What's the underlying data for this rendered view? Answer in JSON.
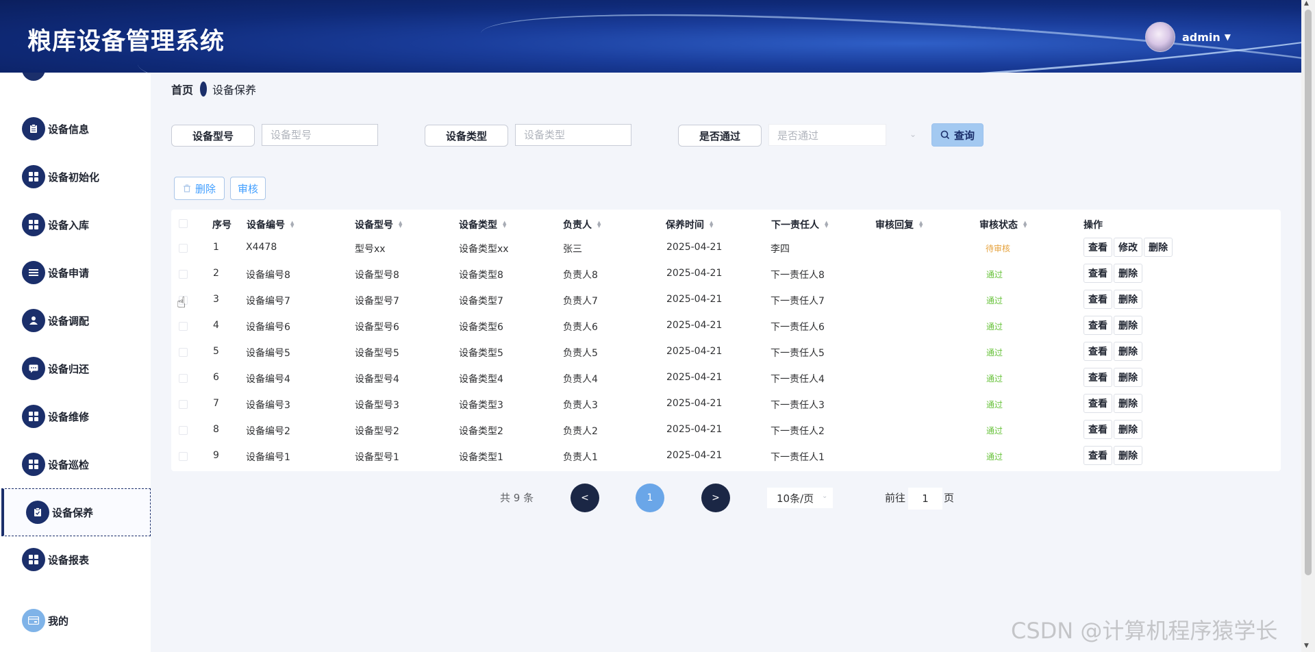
{
  "app": {
    "title": "粮库设备管理系统"
  },
  "user": {
    "name": "admin"
  },
  "breadcrumb": {
    "home": "首页",
    "current": "设备保养"
  },
  "sidebar": {
    "items": [
      {
        "label": "设备信息",
        "icon": "clipboard-icon"
      },
      {
        "label": "设备初始化",
        "icon": "grid-icon"
      },
      {
        "label": "设备入库",
        "icon": "grid-icon"
      },
      {
        "label": "设备申请",
        "icon": "list-icon"
      },
      {
        "label": "设备调配",
        "icon": "user-icon"
      },
      {
        "label": "设备归还",
        "icon": "chat-icon"
      },
      {
        "label": "设备维修",
        "icon": "grid-icon"
      },
      {
        "label": "设备巡检",
        "icon": "grid-icon"
      },
      {
        "label": "设备保养",
        "icon": "clipboard-check-icon",
        "active": true
      },
      {
        "label": "设备报表",
        "icon": "grid-icon"
      },
      {
        "label": "我的",
        "icon": "card-icon"
      }
    ]
  },
  "search": {
    "model_label": "设备型号",
    "model_placeholder": "设备型号",
    "type_label": "设备类型",
    "type_placeholder": "设备类型",
    "pass_label": "是否通过",
    "pass_placeholder": "是否通过",
    "query_label": "查询"
  },
  "actions": {
    "delete_label": "删除",
    "audit_label": "审核"
  },
  "table": {
    "columns": [
      "序号",
      "设备编号",
      "设备型号",
      "设备类型",
      "负责人",
      "保养时间",
      "下一责任人",
      "审核回复",
      "审核状态",
      "操作"
    ],
    "rows": [
      {
        "index": "1",
        "code": "X4478",
        "model": "型号xx",
        "type": "设备类型xx",
        "owner": "张三",
        "date": "2025-04-21",
        "next": "李四",
        "reply": "",
        "status": "待审核",
        "ops": [
          "查看",
          "修改",
          "删除"
        ]
      },
      {
        "index": "2",
        "code": "设备编号8",
        "model": "设备型号8",
        "type": "设备类型8",
        "owner": "负责人8",
        "date": "2025-04-21",
        "next": "下一责任人8",
        "reply": "",
        "status": "通过",
        "ops": [
          "查看",
          "删除"
        ]
      },
      {
        "index": "3",
        "code": "设备编号7",
        "model": "设备型号7",
        "type": "设备类型7",
        "owner": "负责人7",
        "date": "2025-04-21",
        "next": "下一责任人7",
        "reply": "",
        "status": "通过",
        "ops": [
          "查看",
          "删除"
        ]
      },
      {
        "index": "4",
        "code": "设备编号6",
        "model": "设备型号6",
        "type": "设备类型6",
        "owner": "负责人6",
        "date": "2025-04-21",
        "next": "下一责任人6",
        "reply": "",
        "status": "通过",
        "ops": [
          "查看",
          "删除"
        ]
      },
      {
        "index": "5",
        "code": "设备编号5",
        "model": "设备型号5",
        "type": "设备类型5",
        "owner": "负责人5",
        "date": "2025-04-21",
        "next": "下一责任人5",
        "reply": "",
        "status": "通过",
        "ops": [
          "查看",
          "删除"
        ]
      },
      {
        "index": "6",
        "code": "设备编号4",
        "model": "设备型号4",
        "type": "设备类型4",
        "owner": "负责人4",
        "date": "2025-04-21",
        "next": "下一责任人4",
        "reply": "",
        "status": "通过",
        "ops": [
          "查看",
          "删除"
        ]
      },
      {
        "index": "7",
        "code": "设备编号3",
        "model": "设备型号3",
        "type": "设备类型3",
        "owner": "负责人3",
        "date": "2025-04-21",
        "next": "下一责任人3",
        "reply": "",
        "status": "通过",
        "ops": [
          "查看",
          "删除"
        ]
      },
      {
        "index": "8",
        "code": "设备编号2",
        "model": "设备型号2",
        "type": "设备类型2",
        "owner": "负责人2",
        "date": "2025-04-21",
        "next": "下一责任人2",
        "reply": "",
        "status": "通过",
        "ops": [
          "查看",
          "删除"
        ]
      },
      {
        "index": "9",
        "code": "设备编号1",
        "model": "设备型号1",
        "type": "设备类型1",
        "owner": "负责人1",
        "date": "2025-04-21",
        "next": "下一责任人1",
        "reply": "",
        "status": "通过",
        "ops": [
          "查看",
          "删除"
        ]
      }
    ]
  },
  "pagination": {
    "total": "共 9 条",
    "prev": "<",
    "current": "1",
    "next": ">",
    "page_size": "10条/页",
    "goto_label": "前往",
    "goto_value": "1",
    "goto_unit": "页"
  },
  "watermark": "CSDN @计算机程序猿学长",
  "colors": {
    "navy": "#1b2f6b",
    "accent_blue": "#409eff",
    "pending": "#e6a23c",
    "pass": "#67c23a",
    "page_active": "#6aa6e8"
  }
}
